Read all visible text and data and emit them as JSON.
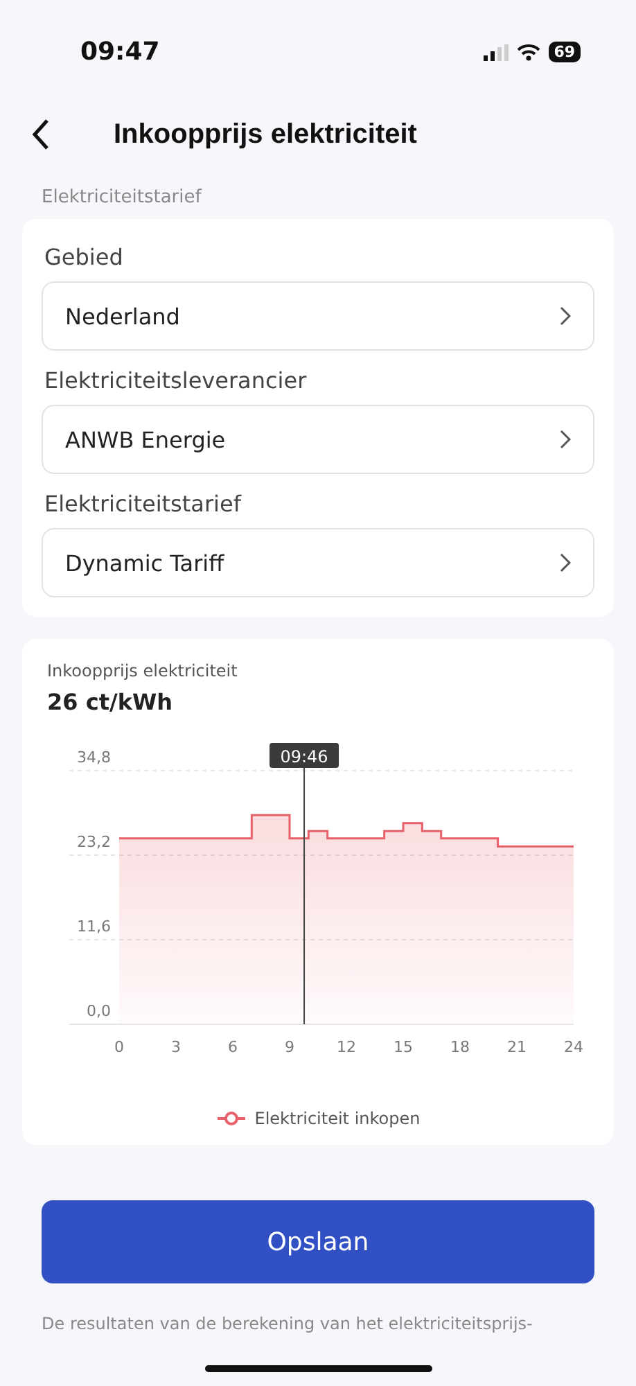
{
  "status_bar": {
    "time": "09:47",
    "battery": "69"
  },
  "header": {
    "title": "Inkoopprijs elektriciteit"
  },
  "section_label": "Elektriciteitstarief",
  "fields": [
    {
      "label": "Gebied",
      "value": "Nederland"
    },
    {
      "label": "Elektriciteitsleverancier",
      "value": "ANWB Energie"
    },
    {
      "label": "Elektriciteitstarief",
      "value": "Dynamic Tariff"
    }
  ],
  "price_card": {
    "title": "Inkoopprijs elektriciteit",
    "price": "26 ct/kWh",
    "cursor_label": "09:46",
    "chart_data": {
      "type": "area",
      "x": [
        0,
        7,
        7,
        9,
        9,
        10,
        10,
        11,
        11,
        14,
        14,
        15,
        15,
        16,
        16,
        17,
        17,
        20,
        20,
        24
      ],
      "series": [
        {
          "name": "Elektriciteit inkopen",
          "color": "#e8606a",
          "values": [
            25.5,
            25.5,
            28.7,
            28.7,
            25.5,
            25.5,
            26.5,
            26.5,
            25.5,
            25.5,
            26.5,
            26.5,
            27.6,
            27.6,
            26.5,
            26.5,
            25.5,
            25.5,
            24.4,
            24.4
          ]
        }
      ],
      "xlim": [
        0,
        24
      ],
      "ylim": [
        0,
        34.8
      ],
      "xticks": [
        0,
        3,
        6,
        9,
        12,
        15,
        18,
        21,
        24
      ],
      "yticks": [
        {
          "value": 0,
          "label": "0,0"
        },
        {
          "value": 11.6,
          "label": "11,6"
        },
        {
          "value": 23.2,
          "label": "23,2"
        },
        {
          "value": 34.8,
          "label": "34,8"
        }
      ]
    }
  },
  "save_button": "Opslaan",
  "disclaimer": "De resultaten van de berekening van het elektriciteitsprijs-"
}
